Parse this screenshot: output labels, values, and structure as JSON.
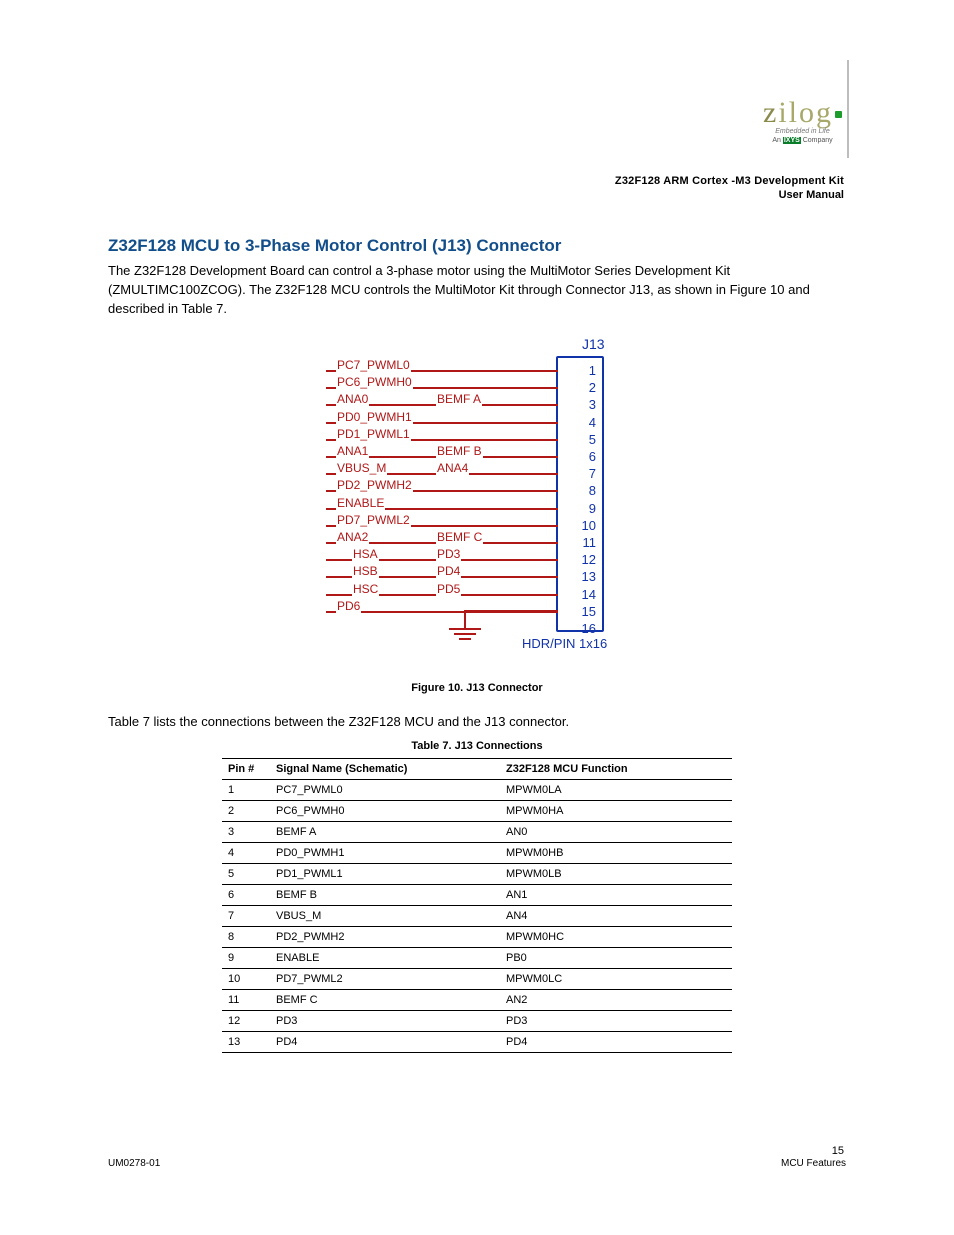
{
  "logo": {
    "brand": "zilog",
    "tagline": "Embedded in Life",
    "company_prefix": "An ",
    "company_ixys": "IXYS",
    "company_suffix": " Company"
  },
  "doc": {
    "title_line1": "Z32F128 ARM Cortex -M3 Development Kit",
    "title_line2": "User Manual"
  },
  "section": {
    "heading": "Z32F128 MCU to 3-Phase Motor Control (J13) Connector",
    "body": "The Z32F128 Development Board can control a 3-phase motor using the MultiMotor Series Development Kit (ZMULTIMC100ZCOG). The Z32F128 MCU controls the MultiMotor Kit through Connector J13, as shown in Figure 10 and described in Table 7."
  },
  "figure": {
    "j13": "J13",
    "type": "HDR/PIN 1x16",
    "caption": "Figure 10. J13 Connector",
    "pins": [
      {
        "n": "1",
        "left": "PC7_PWML0",
        "right": ""
      },
      {
        "n": "2",
        "left": "PC6_PWMH0",
        "right": ""
      },
      {
        "n": "3",
        "left": "ANA0",
        "right": "BEMF A"
      },
      {
        "n": "4",
        "left": "PD0_PWMH1",
        "right": ""
      },
      {
        "n": "5",
        "left": "PD1_PWML1",
        "right": ""
      },
      {
        "n": "6",
        "left": "ANA1",
        "right": "BEMF B"
      },
      {
        "n": "7",
        "left": "VBUS_M",
        "right": "ANA4"
      },
      {
        "n": "8",
        "left": "PD2_PWMH2",
        "right": ""
      },
      {
        "n": "9",
        "left": "ENABLE",
        "right": ""
      },
      {
        "n": "10",
        "left": "PD7_PWML2",
        "right": ""
      },
      {
        "n": "11",
        "left": "ANA2",
        "right": "BEMF C"
      },
      {
        "n": "12",
        "left": "HSA",
        "right": "PD3"
      },
      {
        "n": "13",
        "left": "HSB",
        "right": "PD4"
      },
      {
        "n": "14",
        "left": "HSC",
        "right": "PD5"
      },
      {
        "n": "15",
        "left": "PD6",
        "right": ""
      },
      {
        "n": "16",
        "left": "",
        "right": ""
      }
    ]
  },
  "table": {
    "intro": "Table 7 lists the connections between the Z32F128 MCU and the J13 connector.",
    "caption": "Table 7. J13 Connections",
    "headers": {
      "pin": "Pin #",
      "sig": "Signal Name (Schematic)",
      "func": "Z32F128 MCU Function"
    },
    "rows": [
      {
        "pin": "1",
        "sig": "PC7_PWML0",
        "func": "MPWM0LA"
      },
      {
        "pin": "2",
        "sig": "PC6_PWMH0",
        "func": "MPWM0HA"
      },
      {
        "pin": "3",
        "sig": "BEMF A",
        "func": "AN0"
      },
      {
        "pin": "4",
        "sig": "PD0_PWMH1",
        "func": "MPWM0HB"
      },
      {
        "pin": "5",
        "sig": "PD1_PWML1",
        "func": "MPWM0LB"
      },
      {
        "pin": "6",
        "sig": "BEMF B",
        "func": "AN1"
      },
      {
        "pin": "7",
        "sig": "VBUS_M",
        "func": "AN4"
      },
      {
        "pin": "8",
        "sig": "PD2_PWMH2",
        "func": "MPWM0HC"
      },
      {
        "pin": "9",
        "sig": "ENABLE",
        "func": "PB0"
      },
      {
        "pin": "10",
        "sig": "PD7_PWML2",
        "func": "MPWM0LC"
      },
      {
        "pin": "11",
        "sig": "BEMF C",
        "func": "AN2"
      },
      {
        "pin": "12",
        "sig": "PD3",
        "func": "PD3"
      },
      {
        "pin": "13",
        "sig": "PD4",
        "func": "PD4"
      }
    ]
  },
  "footer": {
    "docnum": "UM0278-01",
    "page": "15",
    "section": "MCU Features"
  }
}
